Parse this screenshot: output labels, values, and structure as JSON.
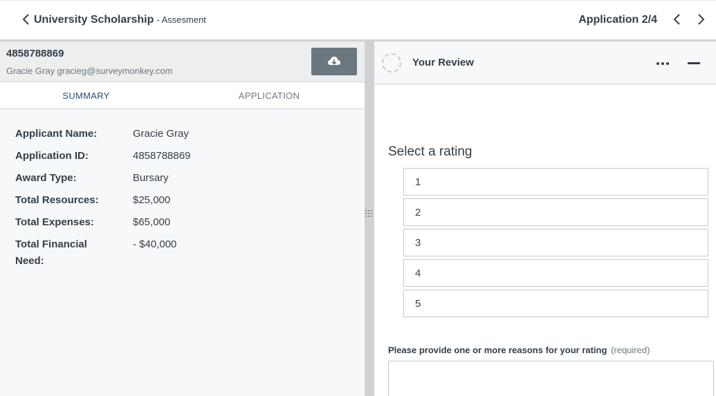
{
  "header": {
    "title": "University Scholarship",
    "subtitle": "- Assesment",
    "app_counter": "Application 2/4",
    "back_icon": "chevron-left-icon",
    "prev_icon": "chevron-left-icon",
    "next_icon": "chevron-right-icon"
  },
  "applicant": {
    "id": "4858788869",
    "contact": "Gracie Gray gracieg@surveymonkey.com",
    "download_icon": "cloud-download-icon"
  },
  "tabs": [
    {
      "label": "SUMMARY",
      "active": true
    },
    {
      "label": "APPLICATION",
      "active": false
    }
  ],
  "summary": [
    {
      "label": "Applicant Name:",
      "value": "Gracie Gray"
    },
    {
      "label": "Application ID:",
      "value": "4858788869"
    },
    {
      "label": "Award Type:",
      "value": "Bursary"
    },
    {
      "label": "Total Resources:",
      "value": "$25,000"
    },
    {
      "label": "Total Expenses:",
      "value": "$65,000"
    },
    {
      "label": "Total Financial Need:",
      "value": "- $40,000"
    }
  ],
  "review": {
    "title": "Your Review",
    "rating_prompt": "Select a rating",
    "rating_options": [
      "1",
      "2",
      "3",
      "4",
      "5"
    ],
    "reason_label": "Please provide one or more reasons for your rating",
    "reason_required": "(required)",
    "reason_value": ""
  },
  "colors": {
    "active_tab": "#2a4c7d",
    "download_button": "#6b787f",
    "text": "#333e48"
  }
}
